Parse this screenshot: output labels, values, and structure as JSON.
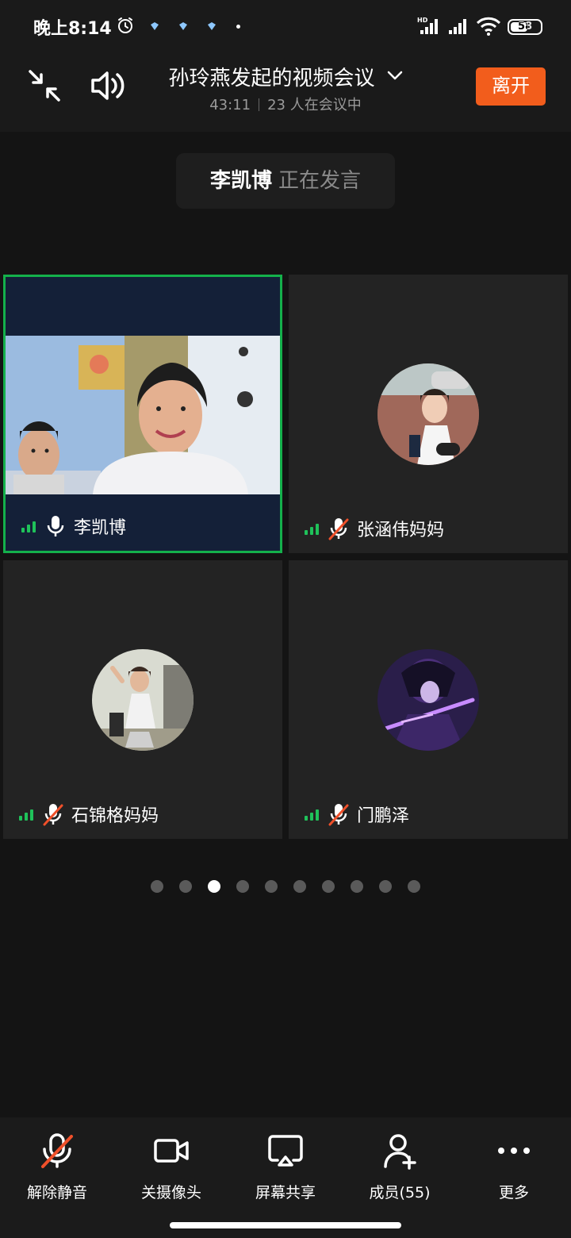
{
  "status_bar": {
    "time": "晚上8:14",
    "battery": "58",
    "icons": [
      "alarm-icon",
      "app-icon",
      "app-icon",
      "app-icon",
      "hd-signal-icon",
      "signal-icon",
      "wifi-icon",
      "battery-icon"
    ]
  },
  "header": {
    "title": "孙玲燕发起的视频会议",
    "elapsed": "43:11",
    "attendance": "23 人在会议中",
    "leave_label": "离开",
    "icons": [
      "minimize-icon",
      "speaker-icon",
      "chevron-down-icon"
    ]
  },
  "speaking": {
    "name": "李凯博",
    "status": "正在发言"
  },
  "participants": [
    {
      "name": "李凯博",
      "mic": "on",
      "video": true,
      "speaking": true
    },
    {
      "name": "张涵伟妈妈",
      "mic": "muted",
      "video": false
    },
    {
      "name": "石锦格妈妈",
      "mic": "muted",
      "video": false
    },
    {
      "name": "门鹏泽",
      "mic": "muted",
      "video": false
    }
  ],
  "pager": {
    "total": 10,
    "current": 3
  },
  "toolbar": {
    "unmute": "解除静音",
    "camera": "关摄像头",
    "share": "屏幕共享",
    "members": "成员(55)",
    "more": "更多"
  },
  "colors": {
    "accent_leave": "#f25d1c",
    "active_border": "#14b14b",
    "signal_green": "#1fc25a",
    "muted_red": "#f0502a"
  }
}
